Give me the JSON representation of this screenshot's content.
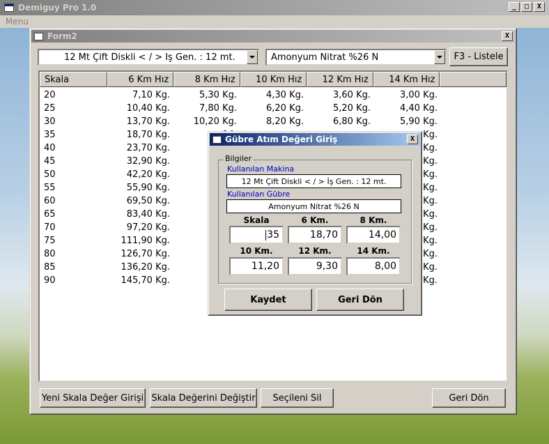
{
  "app": {
    "title": "Demiguy Pro 1.0",
    "menu": [
      "Menu"
    ],
    "window_buttons": {
      "minimize": "_",
      "maximize": "□",
      "close": "X"
    }
  },
  "form2": {
    "title": "Form2",
    "machine_combo": "12 Mt Çift Diskli  < / >  İş Gen. : 12 mt.",
    "fertilizer_combo": "Amonyum Nitrat %26 N",
    "list_button": "F3 - Listele",
    "columns": [
      "Skala",
      "6 Km Hız",
      "8 Km Hız",
      "10 Km Hız",
      "12 Km Hız",
      "14 Km Hız"
    ],
    "rows": [
      [
        "20",
        "7,10 Kg.",
        "5,30 Kg.",
        "4,30 Kg.",
        "3,60 Kg.",
        "3,00 Kg."
      ],
      [
        "25",
        "10,40 Kg.",
        "7,80 Kg.",
        "6,20 Kg.",
        "5,20 Kg.",
        "4,40 Kg."
      ],
      [
        "30",
        "13,70 Kg.",
        "10,20 Kg.",
        "8,20 Kg.",
        "6,80 Kg.",
        "5,90 Kg."
      ],
      [
        "35",
        "18,70 Kg.",
        "14,",
        "",
        "",
        "Kg."
      ],
      [
        "40",
        "23,70 Kg.",
        "17,",
        "",
        "",
        "Kg."
      ],
      [
        "45",
        "32,90 Kg.",
        "24,",
        "",
        "",
        "Kg."
      ],
      [
        "50",
        "42,20 Kg.",
        "31,",
        "",
        "",
        "Kg."
      ],
      [
        "55",
        "55,90 Kg.",
        "41,",
        "",
        "",
        "Kg."
      ],
      [
        "60",
        "69,50 Kg.",
        "52,",
        "",
        "",
        "Kg."
      ],
      [
        "65",
        "83,40 Kg.",
        "62,",
        "",
        "",
        "Kg."
      ],
      [
        "70",
        "97,20 Kg.",
        "72,",
        "",
        "",
        "Kg."
      ],
      [
        "75",
        "111,90 Kg.",
        "84,",
        "",
        "",
        "Kg."
      ],
      [
        "80",
        "126,70 Kg.",
        "95,",
        "",
        "",
        "Kg."
      ],
      [
        "85",
        "136,20 Kg.",
        "102,",
        "",
        "",
        "Kg."
      ],
      [
        "90",
        "145,70 Kg.",
        "109,",
        "",
        "",
        "Kg."
      ]
    ],
    "buttons": {
      "new_scale": "Yeni Skala Değer Girişi",
      "change_scale": "Skala Değerini Değiştir",
      "delete_selected": "Seçileni Sil",
      "back": "Geri Dön"
    }
  },
  "dialog": {
    "title": "Gübre Atım Değeri Giriş",
    "group_label": "Bilgiler",
    "machine_label": "Kullanılan Makina",
    "machine_value": "12 Mt Çift Diskli  < / >  İş Gen. : 12 mt.",
    "fertilizer_label": "Kullanılan Gübre",
    "fertilizer_value": "Amonyum Nitrat %26 N",
    "fields": {
      "skala": {
        "label": "Skala",
        "value": "35"
      },
      "km6": {
        "label": "6 Km.",
        "value": "18,70"
      },
      "km8": {
        "label": "8 Km.",
        "value": "14,00"
      },
      "km10": {
        "label": "10 Km.",
        "value": "11,20"
      },
      "km12": {
        "label": "12 Km.",
        "value": "9,30"
      },
      "km14": {
        "label": "14 Km.",
        "value": "8,00"
      }
    },
    "save_button": "Kaydet",
    "back_button": "Geri Dön"
  }
}
